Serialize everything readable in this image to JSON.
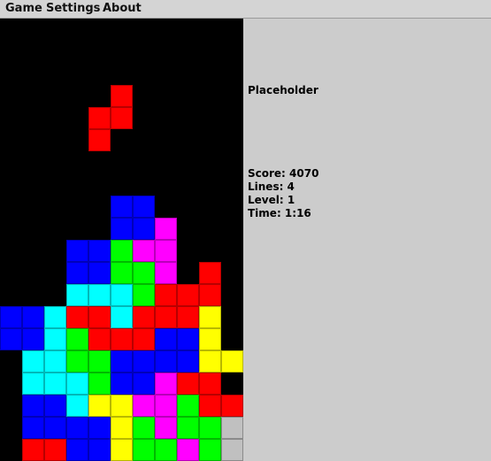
{
  "menu": {
    "game": "Game",
    "settings": "Settings",
    "about": "About"
  },
  "side_panel": {
    "next_piece": "Placeholder",
    "score": "Score: 4070",
    "lines": "Lines: 4",
    "level": "Level: 1",
    "time": "Time: 1:16"
  },
  "board": {
    "columns": 11,
    "rows": 20,
    "colors": {
      "R": "#ff0000",
      "B": "#0000ff",
      "C": "#00ffff",
      "G": "#00ff00",
      "M": "#ff00ff",
      "Y": "#ffff00",
      "S": "#c0c0c0"
    },
    "falling_piece": {
      "color": "R",
      "cells": [
        [
          5,
          3
        ],
        [
          4,
          4
        ],
        [
          5,
          4
        ],
        [
          4,
          5
        ]
      ]
    },
    "grid": [
      "...........",
      "...........",
      "...........",
      "...........",
      "...........",
      "...........",
      "...........",
      "...........",
      ".....BB....",
      ".....BBM...",
      "...BBGMM...",
      "...BBGGM.R.",
      "...CCCGRRR.",
      "BBCRRCRRRY.",
      "BBCGRRRBBY.",
      ".CCGGBBBBYY",
      ".CCCGBBMRR.",
      ".BBCYYMMGRR",
      ".BBBBYGMGGS",
      ".RRBBYGGMGS"
    ]
  }
}
